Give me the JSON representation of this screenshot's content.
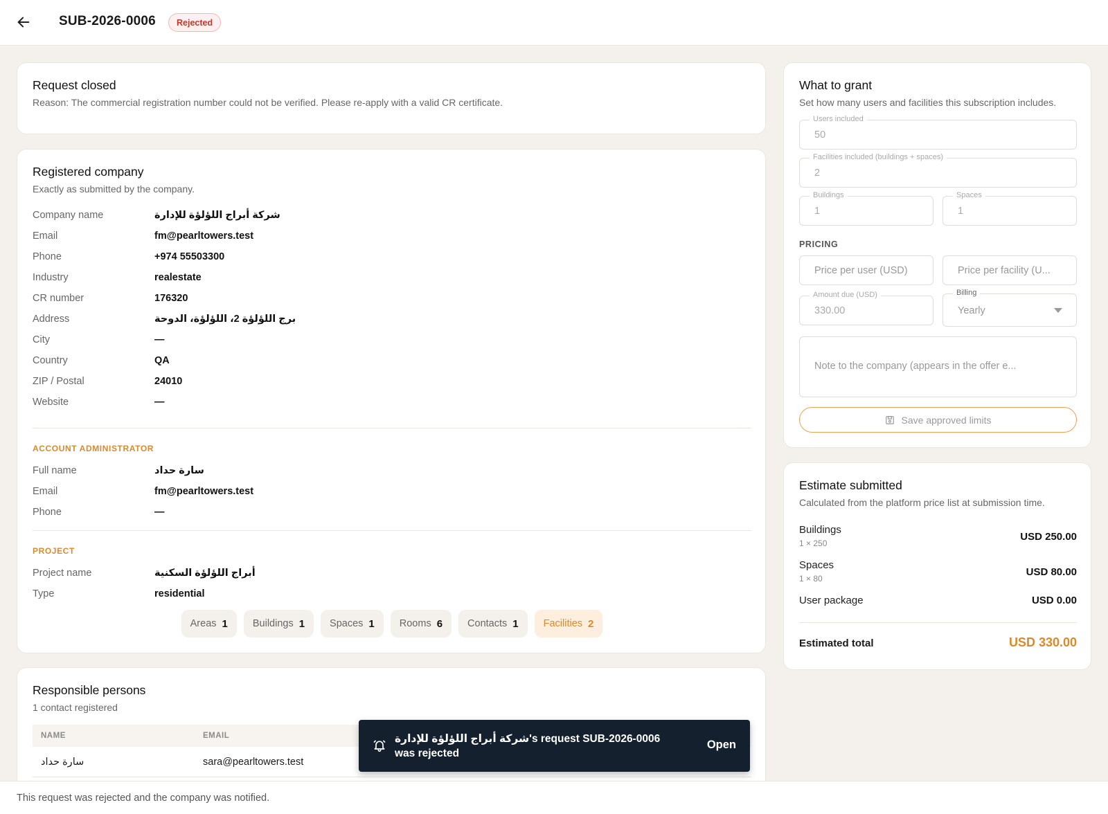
{
  "header": {
    "request_id": "SUB-2026-0006",
    "status": "Rejected"
  },
  "closed": {
    "title": "Request closed",
    "reason": "Reason: The commercial registration number could not be verified. Please re-apply with a valid CR certificate."
  },
  "company": {
    "title": "Registered company",
    "subtitle": "Exactly as submitted by the company.",
    "fields": [
      {
        "label": "Company name",
        "value": "شركة أبراج اللؤلؤة للإدارة"
      },
      {
        "label": "Email",
        "value": "fm@pearltowers.test"
      },
      {
        "label": "Phone",
        "value": "+974 55503300"
      },
      {
        "label": "Industry",
        "value": "realestate"
      },
      {
        "label": "CR number",
        "value": "176320"
      },
      {
        "label": "Address",
        "value": "برج اللؤلؤة 2، اللؤلؤة، الدوحة"
      },
      {
        "label": "City",
        "value": "—"
      },
      {
        "label": "Country",
        "value": "QA"
      },
      {
        "label": "ZIP / Postal",
        "value": "24010"
      },
      {
        "label": "Website",
        "value": "—"
      }
    ],
    "admin_label": "ACCOUNT ADMINISTRATOR",
    "admin": [
      {
        "label": "Full name",
        "value": "سارة حداد"
      },
      {
        "label": "Email",
        "value": "fm@pearltowers.test"
      },
      {
        "label": "Phone",
        "value": "—"
      }
    ],
    "project_label": "PROJECT",
    "project": [
      {
        "label": "Project name",
        "value": "أبراج اللؤلؤة السكنية"
      },
      {
        "label": "Type",
        "value": "residential"
      }
    ],
    "chips": [
      {
        "label": "Areas",
        "count": "1"
      },
      {
        "label": "Buildings",
        "count": "1"
      },
      {
        "label": "Spaces",
        "count": "1"
      },
      {
        "label": "Rooms",
        "count": "6"
      },
      {
        "label": "Contacts",
        "count": "1"
      },
      {
        "label": "Facilities",
        "count": "2"
      }
    ]
  },
  "persons": {
    "title": "Responsible persons",
    "subtitle": "1 contact registered",
    "columns": [
      "NAME",
      "EMAIL"
    ],
    "rows": [
      {
        "name": "سارة حداد",
        "email": "sara@pearltowers.test"
      }
    ]
  },
  "grant": {
    "title": "What to grant",
    "subtitle": "Set how many users and facilities this subscription includes.",
    "users_label": "Users included",
    "users_value": "50",
    "facilities_label": "Facilities included (buildings + spaces)",
    "facilities_value": "2",
    "buildings_label": "Buildings",
    "buildings_value": "1",
    "spaces_label": "Spaces",
    "spaces_value": "1",
    "pricing_label": "PRICING",
    "price_user_placeholder": "Price per user (USD)",
    "price_facility_placeholder": "Price per facility (U...",
    "amount_label": "Amount due (USD)",
    "amount_value": "330.00",
    "billing_label": "Billing",
    "billing_value": "Yearly",
    "note_placeholder": "Note to the company (appears in the offer e...",
    "save_label": "Save approved limits"
  },
  "estimate": {
    "title": "Estimate submitted",
    "subtitle": "Calculated from the platform price list at submission time.",
    "rows": [
      {
        "name": "Buildings",
        "calc": "1 × 250",
        "amount": "USD 250.00"
      },
      {
        "name": "Spaces",
        "calc": "1 × 80",
        "amount": "USD 80.00"
      },
      {
        "name": "User package",
        "calc": "",
        "amount": "USD 0.00"
      }
    ],
    "total_label": "Estimated total",
    "total_amount": "USD 330.00"
  },
  "toast": {
    "message": "شركة أبراج اللؤلؤة للإدارة's request SUB-2026-0006 was rejected",
    "action": "Open"
  },
  "footer": {
    "text": "This request was rejected and the company was notified."
  },
  "colors": {
    "accent": "#d98a2b",
    "rejected": "#c0392b",
    "toast_bg": "#14202e",
    "page_bg": "#f4f1ec"
  }
}
